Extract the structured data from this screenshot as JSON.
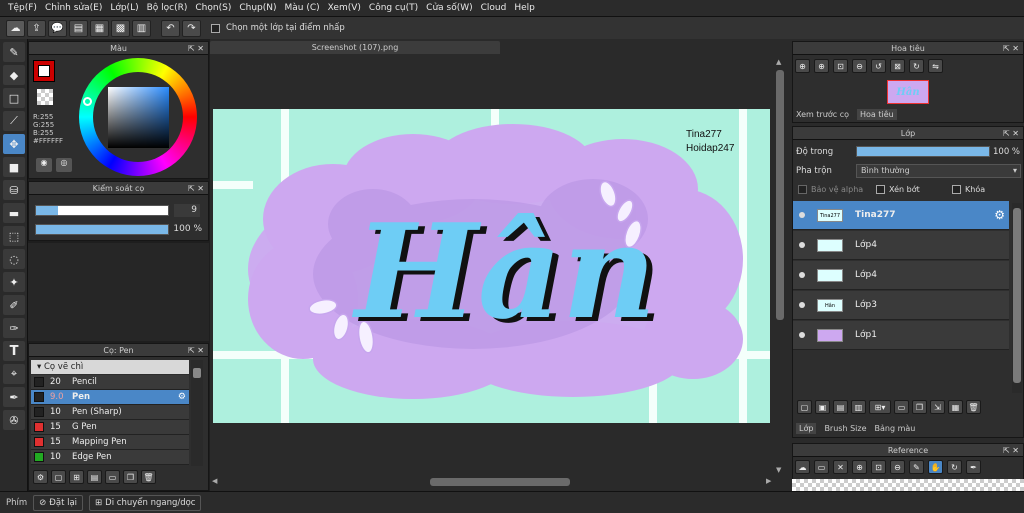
{
  "menu": [
    "Tệp(F)",
    "Chỉnh sửa(E)",
    "Lớp(L)",
    "Bộ lọc(R)",
    "Chọn(S)",
    "Chụp(N)",
    "Màu (C)",
    "Xem(V)",
    "Công cụ(T)",
    "Cửa số(W)",
    "Cloud",
    "Help"
  ],
  "toolbar": {
    "pick_layer_label": "Chọn một lớp tại điểm nhấp"
  },
  "document": {
    "tab_title": "Screenshot (107).png"
  },
  "canvas": {
    "watermark_line1": "Tina277",
    "watermark_line2": "Hoidap247",
    "art_text": "Hân"
  },
  "color_panel": {
    "title": "Màu",
    "r": "R:255",
    "g": "G:255",
    "b": "B:255",
    "hex": "#FFFFFF"
  },
  "brush_control": {
    "title": "Kiểm soát cọ",
    "size": "9",
    "opacity": "100 %",
    "size_fraction": 0.17,
    "opacity_fraction": 1.0
  },
  "brush_panel": {
    "title": "Cọ: Pen",
    "category": "Cọ vẽ chì",
    "items": [
      {
        "size": "20",
        "name": "Pencil",
        "color": "#222222"
      },
      {
        "size": "9.0",
        "name": "Pen",
        "color": "#222222"
      },
      {
        "size": "10",
        "name": "Pen (Sharp)",
        "color": "#222222"
      },
      {
        "size": "15",
        "name": "G Pen",
        "color": "#e03030"
      },
      {
        "size": "15",
        "name": "Mapping Pen",
        "color": "#e03030"
      },
      {
        "size": "10",
        "name": "Edge Pen",
        "color": "#22aa22"
      }
    ]
  },
  "navigator": {
    "title": "Hoa tiêu",
    "tab1": "Xem trước cọ",
    "tab2": "Hoa tiêu",
    "thumb_text": "Hân"
  },
  "layers": {
    "title": "Lớp",
    "opacity_label": "Độ trong",
    "opacity_value": "100 %",
    "blend_label": "Pha trộn",
    "blend_value": "Bình thường",
    "protect_alpha": "Bảo vệ alpha",
    "clipping": "Xén bớt",
    "lock": "Khóa",
    "items": [
      {
        "name": "Tina277",
        "thumb": "Tina277 Hoidap247"
      },
      {
        "name": "Lớp4",
        "thumb": ""
      },
      {
        "name": "Lớp4",
        "thumb": ""
      },
      {
        "name": "Lớp3",
        "thumb": "Hân"
      },
      {
        "name": "Lớp1",
        "thumb": ""
      }
    ],
    "tabs": [
      "Lớp",
      "Brush Size",
      "Bảng màu"
    ]
  },
  "reference": {
    "title": "Reference"
  },
  "status": {
    "label": "Phím",
    "reset": "Đặt lại",
    "pan": "Di chuyển ngang/dọc"
  },
  "colors": {
    "accent": "#4a87c7",
    "canvas_bg": "#aef0de",
    "cloud": "#cda8f0",
    "letters": "#6ecdf5"
  }
}
